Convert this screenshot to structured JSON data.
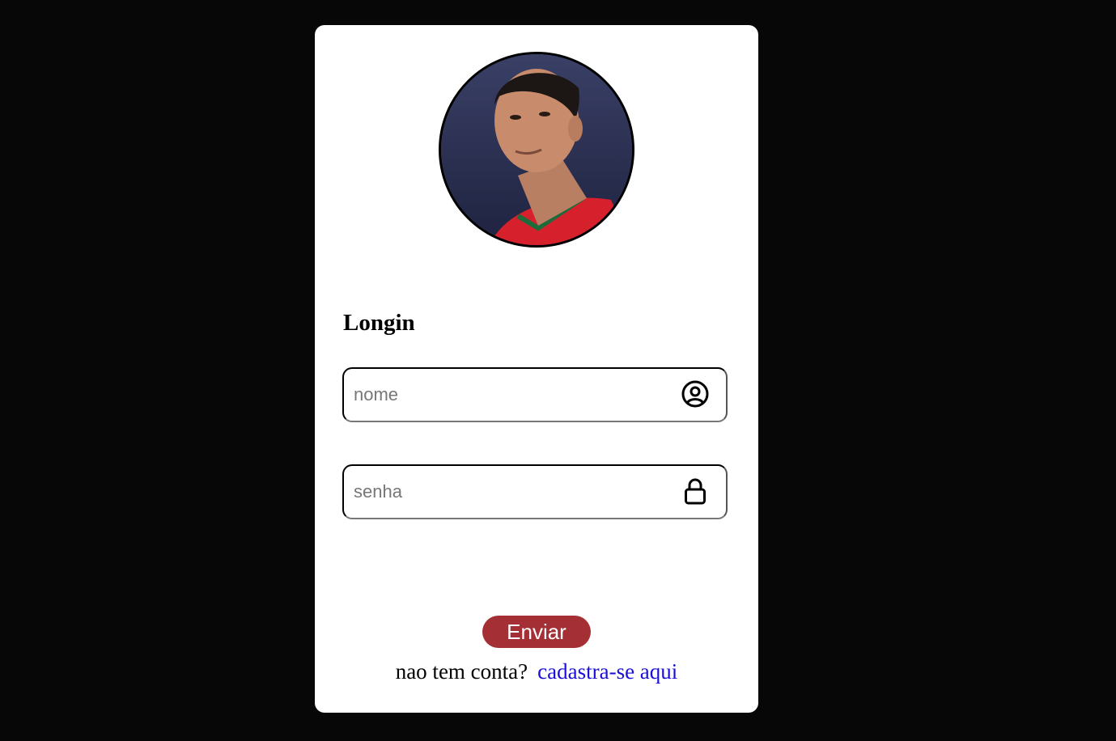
{
  "login": {
    "title": "Longin",
    "username": {
      "placeholder": "nome",
      "value": "",
      "icon": "user-circle-icon"
    },
    "password": {
      "placeholder": "senha",
      "value": "",
      "icon": "lock-icon"
    },
    "submit_label": "Enviar",
    "signup_prompt": "nao tem conta?",
    "signup_link": "cadastra-se aqui"
  },
  "colors": {
    "background": "#070707",
    "card": "#ffffff",
    "button": "#a42f35",
    "link": "#1a0fd8"
  }
}
